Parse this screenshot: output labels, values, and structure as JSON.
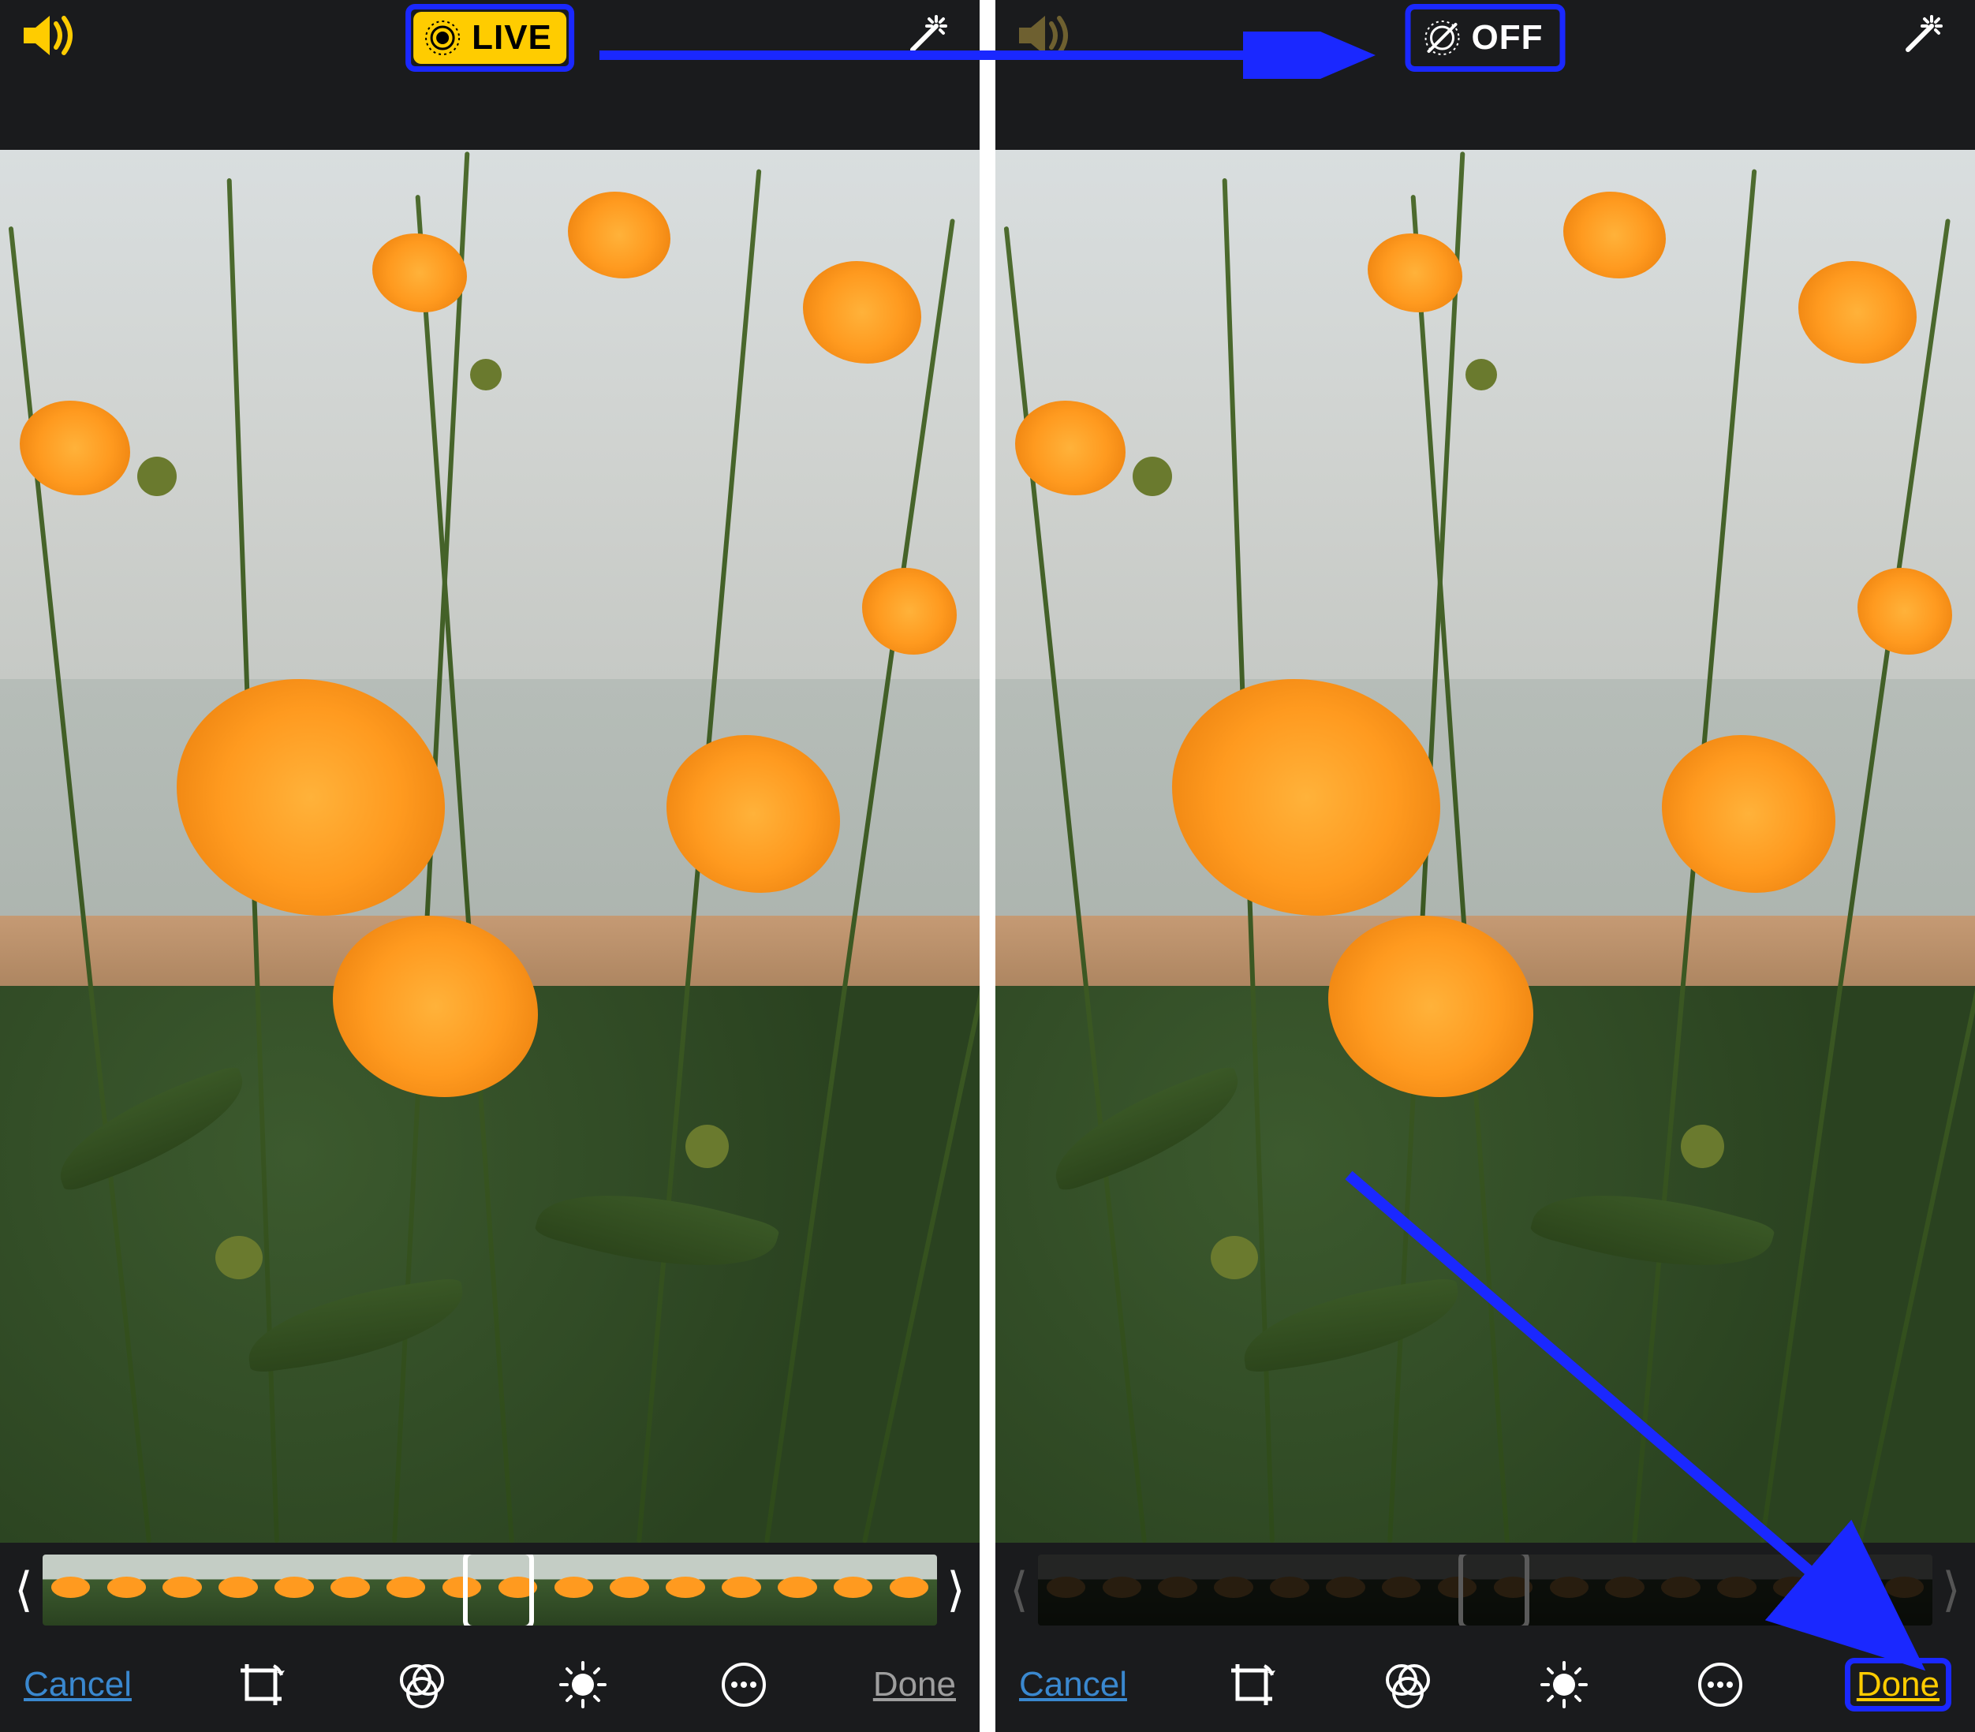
{
  "annotation_color": "#1a28ff",
  "screens": [
    {
      "sound_active": true,
      "live_state": "on",
      "live_label": "LIVE",
      "live_highlighted": true,
      "timeline_dimmed": false,
      "cancel_label": "Cancel",
      "done_label": "Done",
      "done_active": false,
      "done_highlighted": false
    },
    {
      "sound_active": false,
      "live_state": "off",
      "live_label": "OFF",
      "live_highlighted": true,
      "timeline_dimmed": true,
      "cancel_label": "Cancel",
      "done_label": "Done",
      "done_active": true,
      "done_highlighted": true
    }
  ],
  "tool_icons": [
    "crop-rotate",
    "color-filters",
    "light-adjust",
    "more"
  ],
  "timeline_frame_count": 16
}
